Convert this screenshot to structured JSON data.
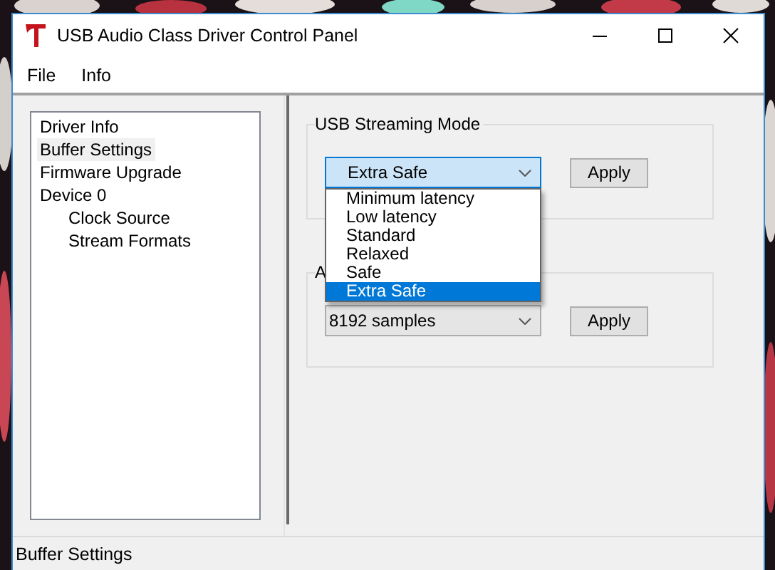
{
  "window": {
    "title": "USB Audio Class Driver Control Panel"
  },
  "menu": [
    "File",
    "Info"
  ],
  "tree": [
    {
      "label": "Driver Info",
      "selected": false
    },
    {
      "label": "Buffer Settings",
      "selected": true
    },
    {
      "label": "Firmware Upgrade",
      "selected": false
    },
    {
      "label": "Device 0",
      "selected": false,
      "children": [
        {
          "label": "Clock Source",
          "selected": false
        },
        {
          "label": "Stream Formats",
          "selected": false
        }
      ]
    }
  ],
  "groups": [
    {
      "legend": "USB Streaming Mode",
      "combo": {
        "value": "Extra Safe",
        "focused": true
      },
      "button": "Apply"
    },
    {
      "legend": "A",
      "combo": {
        "value": "8192 samples",
        "focused": false
      },
      "button": "Apply"
    }
  ],
  "dropdown": {
    "options": [
      {
        "label": "Minimum latency",
        "selected": false
      },
      {
        "label": "Low latency",
        "selected": false
      },
      {
        "label": "Standard",
        "selected": false
      },
      {
        "label": "Relaxed",
        "selected": false
      },
      {
        "label": "Safe",
        "selected": false
      },
      {
        "label": "Extra Safe",
        "selected": true
      }
    ]
  },
  "status_bar": "Buffer Settings"
}
